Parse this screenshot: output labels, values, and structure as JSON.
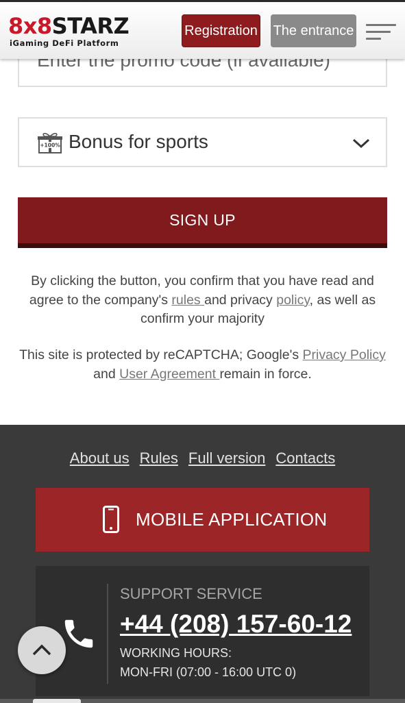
{
  "header": {
    "logo_number_left": "8",
    "logo_x": "x",
    "logo_number_right": "8",
    "logo_word": "STARZ",
    "logo_tagline": "iGaming DeFi Platform",
    "registration_label": "Registration",
    "entrance_label": "The entrance",
    "menu_icon": "hamburger-menu-icon"
  },
  "form": {
    "promo_placeholder": "Enter the promo code (if available)",
    "bonus_icon": "gift-bonus-icon",
    "bonus_icon_text": "+100%",
    "bonus_label": "Bonus for sports",
    "bonus_chevron_icon": "chevron-down-icon",
    "signup_label": "SIGN UP"
  },
  "consent": {
    "part1": "By clicking the button, you confirm that you have read and agree to the company's ",
    "rules_link": "rules ",
    "part2": "and privacy ",
    "policy_link": "policy",
    "part3": ", as well as confirm your majority"
  },
  "recaptcha": {
    "part1": "This site is protected by reCAPTCHA; Google's ",
    "privacy_link": "Privacy Policy",
    "part2": " and ",
    "agreement_link": "User Agreement ",
    "part3": "remain in force."
  },
  "footer": {
    "links": [
      "About us",
      "Rules",
      "Full version",
      "Contacts"
    ],
    "mobile_app_label": "MOBILE APPLICATION",
    "mobile_app_icon": "smartphone-icon",
    "support_title": "SUPPORT SERVICE",
    "support_phone": "+44 (208) 157-60-12",
    "support_icon": "phone-handset-icon",
    "hours_label": "WORKING HOURS:",
    "hours_value": "MON-FRI (07:00 - 16:00 UTC 0)"
  },
  "scroll_top_icon": "chevron-up-icon",
  "colors": {
    "brand_red": "#c8182a",
    "registration_button": "#8e1b1e",
    "signup_button": "#801a1d",
    "mobile_app_button": "#9c2527",
    "entrance_button": "#8a8a8a",
    "footer_background": "#3a3a3a"
  }
}
